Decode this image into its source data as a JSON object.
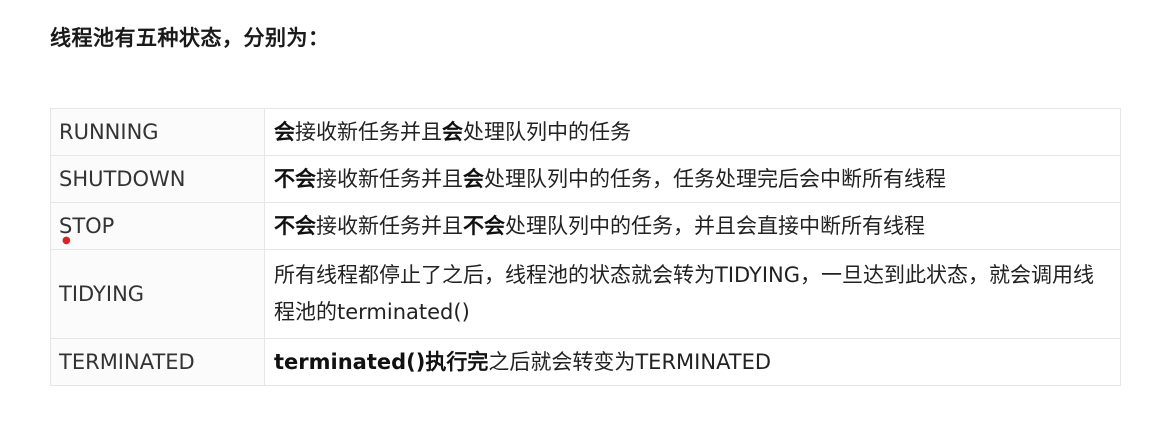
{
  "heading": "线程池有五种状态，分别为：",
  "states": [
    {
      "name": "RUNNING",
      "desc": [
        {
          "text": "会",
          "bold": true
        },
        {
          "text": "接收新任务并且",
          "bold": false
        },
        {
          "text": "会",
          "bold": true
        },
        {
          "text": "处理队列中的任务",
          "bold": false
        }
      ]
    },
    {
      "name": "SHUTDOWN",
      "desc": [
        {
          "text": "不会",
          "bold": true
        },
        {
          "text": "接收新任务并且",
          "bold": false
        },
        {
          "text": "会",
          "bold": true
        },
        {
          "text": "处理队列中的任务，任务处理完后会中断所有线程",
          "bold": false
        }
      ]
    },
    {
      "name": "STOP",
      "desc": [
        {
          "text": "不会",
          "bold": true
        },
        {
          "text": "接收新任务并且",
          "bold": false
        },
        {
          "text": "不会",
          "bold": true
        },
        {
          "text": "处理队列中的任务，并且会直接中断所有线程",
          "bold": false
        }
      ]
    },
    {
      "name": "TIDYING",
      "desc": [
        {
          "text": "所有线程都停止了之后，线程池的状态就会转为TIDYING，一旦达到此状态，就会调用线程池的terminated()",
          "bold": false
        }
      ]
    },
    {
      "name": "TERMINATED",
      "desc": [
        {
          "text": "terminated()执行完",
          "bold": true
        },
        {
          "text": "之后就会转变为TERMINATED",
          "bold": false
        }
      ]
    }
  ]
}
